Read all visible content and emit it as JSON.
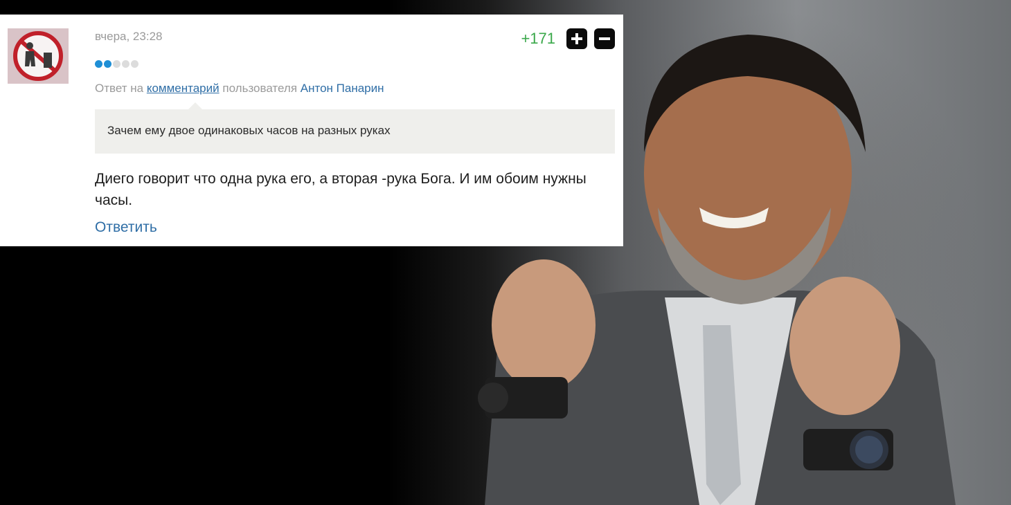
{
  "comment": {
    "timestamp": "вчера, 23:28",
    "rank_dots": {
      "filled": 2,
      "total": 5
    },
    "rating": {
      "value": "+171",
      "upvote_icon": "plus-icon",
      "downvote_icon": "minus-icon"
    },
    "reply_to": {
      "prefix": "Ответ на",
      "link": "комментарий",
      "middle": "пользователя",
      "user": "Антон Панарин"
    },
    "quote": "Зачем ему двое одинаковых часов на разных руках",
    "text": "Диего говорит что одна рука его, а вторая -рука Бога. И им обоим нужны часы.",
    "reply_label": "Ответить",
    "avatar_icon": "no-fuel-sign-icon"
  },
  "colors": {
    "accent_link": "#2f6ea6",
    "rating_positive": "#3aa84a",
    "rank_active": "#1f8fd6",
    "quote_bg": "#efefec"
  }
}
